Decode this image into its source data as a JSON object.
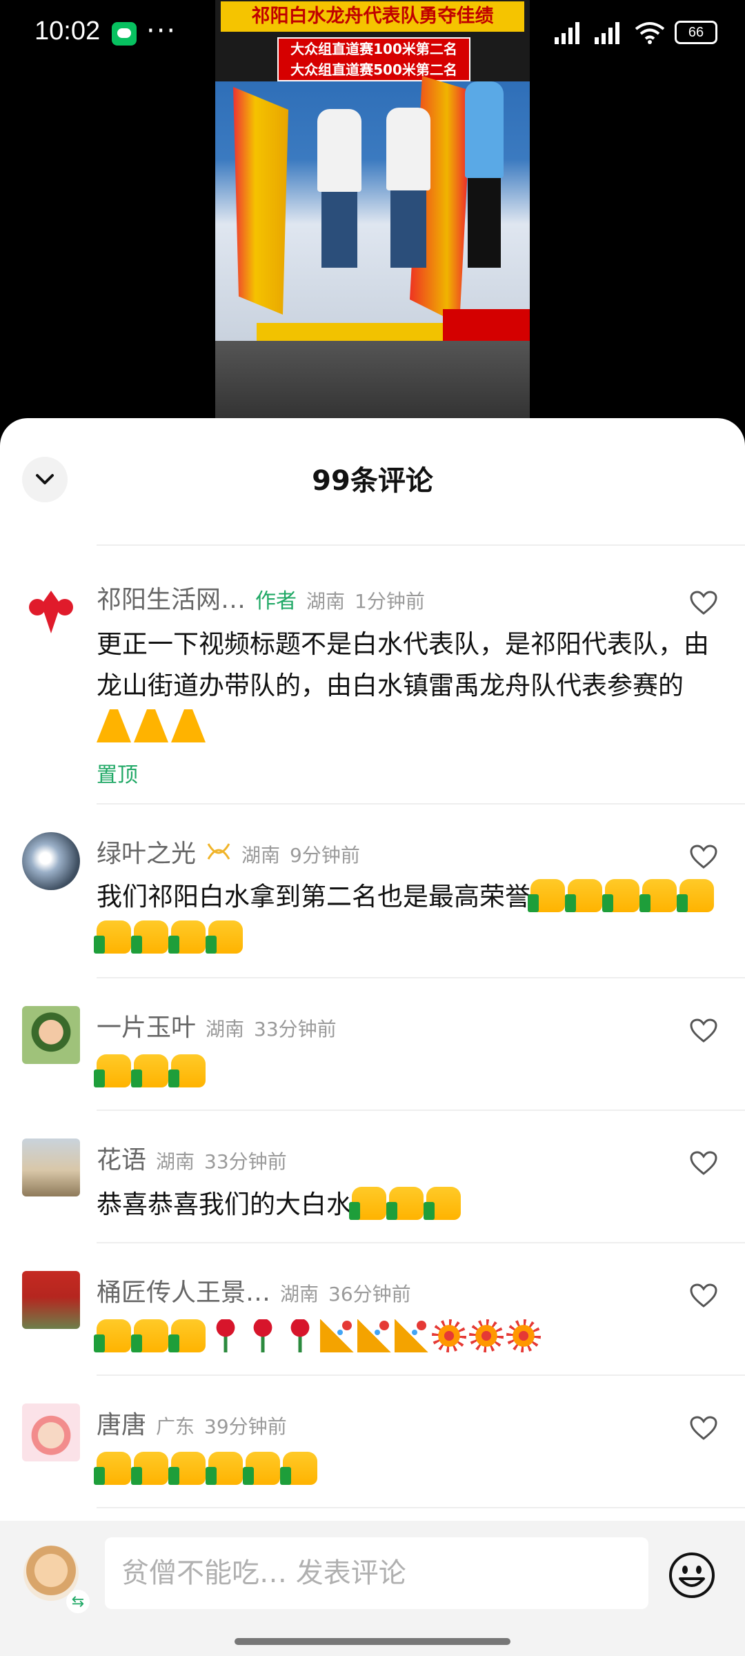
{
  "status_bar": {
    "time": "10:02",
    "battery": "66"
  },
  "video": {
    "title": "祁阳白水龙舟代表队勇夺佳绩",
    "subtitle_line1": "大众组直道赛100米第二名",
    "subtitle_line2": "大众组直道赛500米第二名"
  },
  "comments_header": {
    "title": "99条评论"
  },
  "comments": [
    {
      "name": "祁阳生活网…",
      "author_tag": "作者",
      "location": "湖南",
      "time": "1分钟前",
      "text": "更正一下视频标题不是白水代表队，是祁阳代表队，由龙山街道办带队的，由白水镇雷禹龙舟队代表参赛的",
      "emojis": [
        "pray",
        "pray",
        "pray"
      ],
      "pin_label": "置顶"
    },
    {
      "name": "绿叶之光",
      "location": "湖南",
      "time": "9分钟前",
      "text": "我们祁阳白水拿到第二名也是最高荣誉",
      "emojis": [
        "thumb",
        "thumb",
        "thumb",
        "thumb",
        "thumb",
        "thumb",
        "thumb",
        "thumb",
        "thumb"
      ]
    },
    {
      "name": "一片玉叶",
      "location": "湖南",
      "time": "33分钟前",
      "text": "",
      "emojis": [
        "thumb",
        "thumb",
        "thumb"
      ]
    },
    {
      "name": "花语",
      "location": "湖南",
      "time": "33分钟前",
      "text": "恭喜恭喜我们的大白水",
      "emojis": [
        "thumb",
        "thumb",
        "thumb"
      ]
    },
    {
      "name": "桶匠传人王景…",
      "location": "湖南",
      "time": "36分钟前",
      "text": "",
      "emojis": [
        "thumb",
        "thumb",
        "thumb",
        "rose",
        "rose",
        "rose",
        "party",
        "party",
        "party",
        "firework",
        "firework",
        "firework"
      ]
    },
    {
      "name": "唐唐",
      "location": "广东",
      "time": "39分钟前",
      "text": "",
      "emojis": [
        "thumb",
        "thumb",
        "thumb",
        "thumb",
        "thumb",
        "thumb"
      ]
    }
  ],
  "input": {
    "placeholder": "贫僧不能吃… 发表评论"
  },
  "icons": {
    "collapse": "chevron-down-icon",
    "like": "heart-outline-icon",
    "emoji": "smiley-icon",
    "switch": "swap-icon"
  }
}
